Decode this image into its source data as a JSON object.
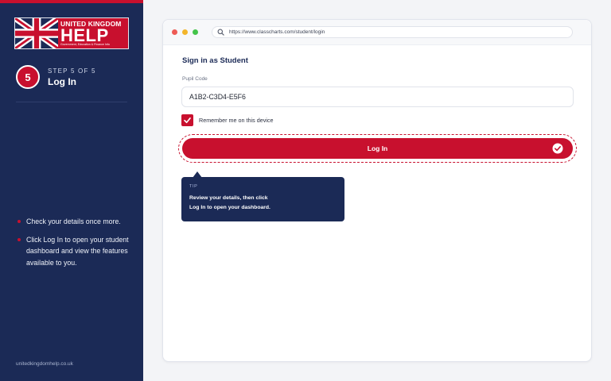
{
  "colors": {
    "brand_red": "#c8102e",
    "navy": "#1b2a56",
    "background": "#f3f4f7"
  },
  "sidebar": {
    "logo": {
      "line1": "UNITED KINGDOM",
      "line2": "HELP",
      "line3": "Government, Education & Finance Info"
    },
    "step": {
      "number": "5",
      "kicker": "STEP 5 OF 5",
      "title": "Log In"
    },
    "bullets": [
      "Check your details once more.",
      "Click Log In to open your student dashboard and view the features available to you."
    ],
    "footer": "unitedkingdomhelp.co.uk"
  },
  "browser": {
    "url": "https://www.classcharts.com/student/login",
    "icons": {
      "url": "search-icon"
    }
  },
  "form": {
    "heading": "Sign in as Student",
    "pupil_code_label": "Pupil Code",
    "pupil_code_value": "A1B2-C3D4-E5F6",
    "remember_label": "Remember me on this device",
    "remember_checked": true,
    "login_label": "Log In",
    "login_icon": "check-circle-icon"
  },
  "tip": {
    "kicker": "TIP",
    "text": "Review your details, then click\nLog In to open your dashboard."
  }
}
